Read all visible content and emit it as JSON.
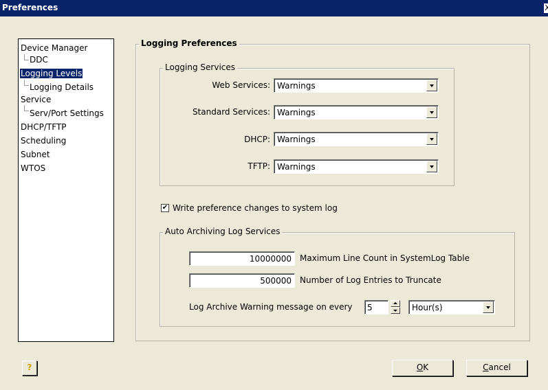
{
  "window": {
    "title": "Preferences",
    "close_glyph": "X"
  },
  "tree": {
    "items": [
      {
        "label": "Device Manager"
      },
      {
        "label": "DDC"
      },
      {
        "label": "Logging Levels"
      },
      {
        "label": "Logging Details"
      },
      {
        "label": "Service"
      },
      {
        "label": "Serv/Port Settings"
      },
      {
        "label": "DHCP/TFTP"
      },
      {
        "label": "Scheduling"
      },
      {
        "label": "Subnet"
      },
      {
        "label": "WTOS"
      }
    ],
    "selected": "Logging Levels"
  },
  "logging_preferences": {
    "title": "Logging Preferences",
    "services_group": {
      "title": "Logging Services",
      "rows": [
        {
          "label": "Web Services:",
          "value": "Warnings"
        },
        {
          "label": "Standard Services:",
          "value": "Warnings"
        },
        {
          "label": "DHCP:",
          "value": "Warnings"
        },
        {
          "label": "TFTP:",
          "value": "Warnings"
        }
      ]
    },
    "write_changes": {
      "label": "Write preference changes to system log",
      "checked": true,
      "check_glyph": "✔"
    },
    "archive_group": {
      "title": "Auto Archiving Log Services",
      "max_lines": {
        "value": "10000000",
        "label": "Maximum Line Count in SystemLog Table"
      },
      "truncate": {
        "value": "500000",
        "label": "Number of Log Entries to Truncate"
      },
      "warning": {
        "label": "Log Archive Warning message on every",
        "interval": "5",
        "unit": "Hour(s)"
      }
    }
  },
  "buttons": {
    "help_glyph": "?",
    "ok": {
      "label": "OK",
      "accel": "O",
      "rest": "K"
    },
    "cancel": {
      "label": "Cancel",
      "accel": "C",
      "rest": "ancel"
    }
  },
  "colors": {
    "titlebar": "#0a246a",
    "dialog_bg": "#ece9d8",
    "selection": "#0a246a"
  }
}
